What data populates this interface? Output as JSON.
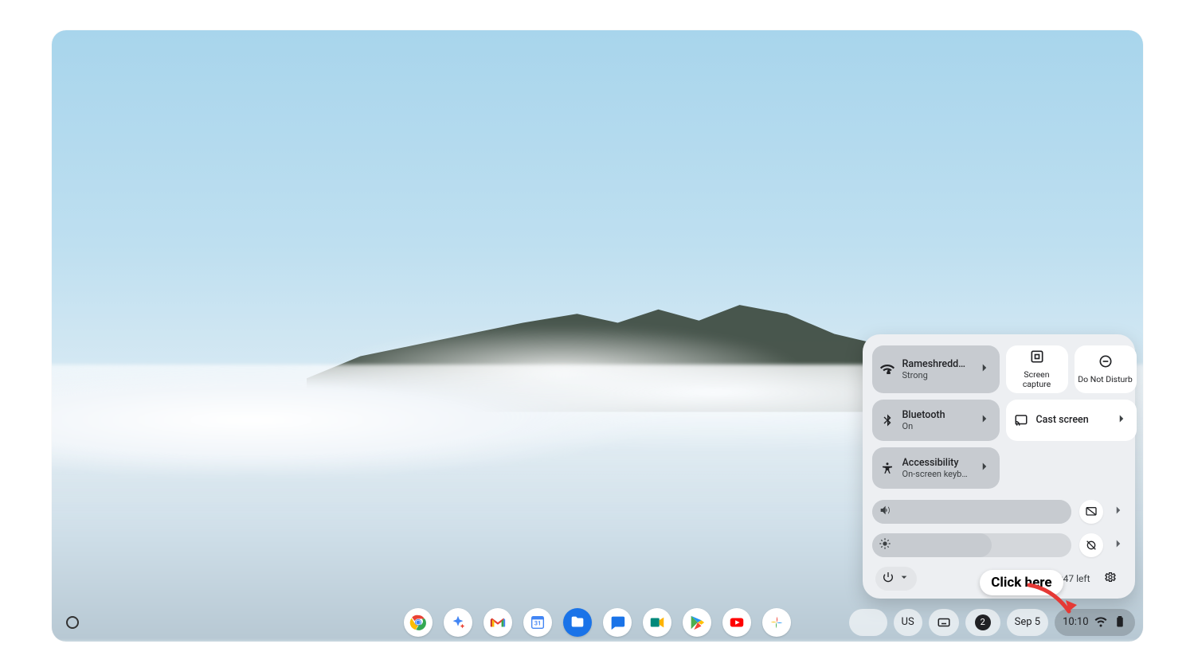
{
  "shelf": {
    "apps": [
      {
        "name": "chrome"
      },
      {
        "name": "assistant"
      },
      {
        "name": "gmail"
      },
      {
        "name": "calendar"
      },
      {
        "name": "files"
      },
      {
        "name": "messages"
      },
      {
        "name": "meet"
      },
      {
        "name": "play-store"
      },
      {
        "name": "youtube"
      },
      {
        "name": "photos"
      }
    ],
    "ime": "US",
    "notif_count": "2",
    "date": "Sep 5",
    "time": "10:10"
  },
  "qs": {
    "wifi": {
      "title": "Rameshreddy…",
      "sub": "Strong"
    },
    "capture": {
      "label": "Screen capture"
    },
    "dnd": {
      "label": "Do Not Disturb"
    },
    "bluetooth": {
      "title": "Bluetooth",
      "sub": "On"
    },
    "cast": {
      "title": "Cast screen"
    },
    "a11y": {
      "title": "Accessibility",
      "sub": "On-screen keyb…"
    },
    "volume_pct": 100,
    "brightness_pct": 60,
    "battery_text": "24% - 15:47 left"
  },
  "annotation": {
    "text": "Click here"
  }
}
